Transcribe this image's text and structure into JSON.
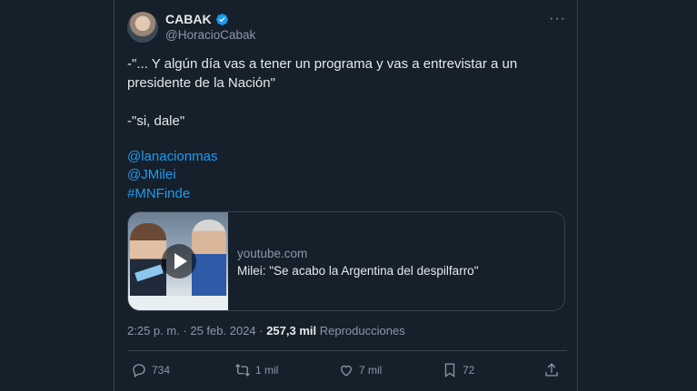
{
  "author": {
    "name": "CABAK",
    "handle": "@HoracioCabak"
  },
  "tweet": {
    "line1": "-\"... Y algún día vas a tener un programa y vas a entrevistar a un",
    "line2": "presidente de la Nación\"",
    "line3": "-\"si, dale\"",
    "links": [
      "@lanacionmas",
      "@JMilei",
      "#MNFinde"
    ]
  },
  "card": {
    "domain": "youtube.com",
    "title": "Milei: \"Se acabo la Argentina del despilfarro\""
  },
  "meta": {
    "time": "2:25 p. m. · 25 feb. 2024 · ",
    "views": "257,3 mil",
    "views_label": " Reproducciones"
  },
  "actions": {
    "replies": "734",
    "retweets": "1 mil",
    "likes": "7 mil",
    "bookmarks": "72"
  },
  "colors": {
    "background": "#15202b",
    "link": "#1d9bf0",
    "verified": "#1d9bf0"
  }
}
